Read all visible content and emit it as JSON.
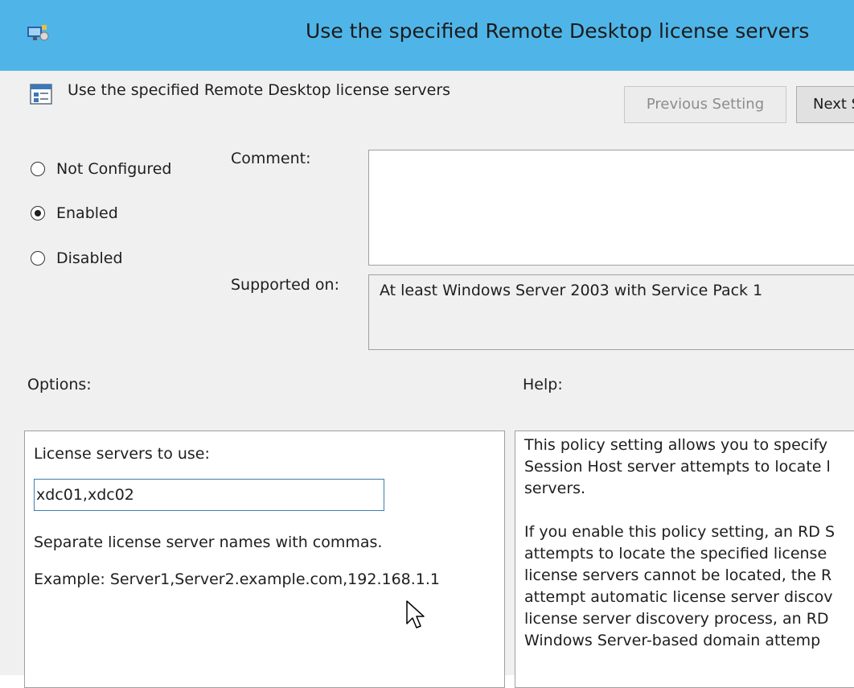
{
  "window": {
    "title": "Use the specified Remote Desktop license servers",
    "accent_color": "#4fb5e8"
  },
  "policy": {
    "heading": "Use the specified Remote Desktop license servers"
  },
  "nav": {
    "previous_label": "Previous Setting",
    "next_label": "Next Setting"
  },
  "state": {
    "options": [
      {
        "label": "Not Configured",
        "selected": false
      },
      {
        "label": "Enabled",
        "selected": true
      },
      {
        "label": "Disabled",
        "selected": false
      }
    ]
  },
  "comment": {
    "label": "Comment:",
    "value": ""
  },
  "supported": {
    "label": "Supported on:",
    "value": "At least Windows Server 2003 with Service Pack 1"
  },
  "options_section": {
    "label": "Options:",
    "servers_label": "License servers to use:",
    "servers_value": "xdc01,xdc02",
    "hint": "Separate license server names with commas.",
    "example": "Example: Server1,Server2.example.com,192.168.1.1"
  },
  "help_section": {
    "label": "Help:",
    "paragraph1": "This policy setting allows you to specify\nSession Host server attempts to locate l\nservers.",
    "paragraph2": "If you enable this policy setting, an RD S\nattempts to locate the specified license\nlicense servers cannot be located, the R\nattempt automatic license server discov\nlicense server discovery process, an RD\nWindows Server-based domain attemp"
  }
}
